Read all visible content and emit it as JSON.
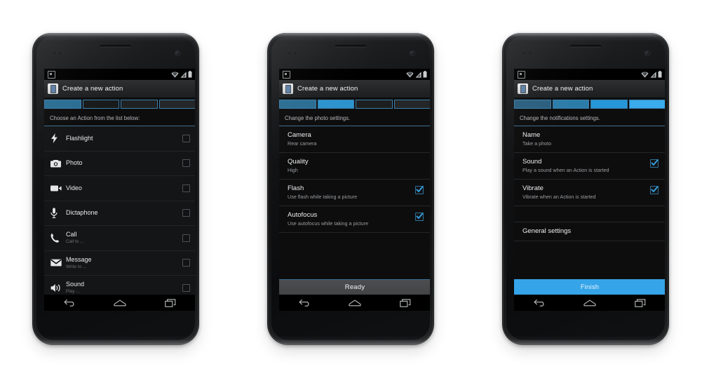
{
  "meta": {
    "app_title": "Create a new action",
    "background": "#ffffff",
    "accent_blue": "#35a4e8"
  },
  "statusbar": {
    "notification_icon": "app-notification-icon",
    "wifi_icon": "wifi-icon",
    "signal_icon": "cellular-signal-icon",
    "battery_icon": "battery-icon"
  },
  "navbar": {
    "back_icon": "back-icon",
    "home_icon": "home-icon",
    "recents_icon": "recent-apps-icon"
  },
  "phones": [
    {
      "id": "phone-1",
      "name": "choose-action-step",
      "action_bar": {
        "title": "Create a new action",
        "icon": "device-icon"
      },
      "progress": {
        "steps": 4,
        "segments": [
          {
            "state": "active",
            "color": "#2b6d93"
          },
          {
            "state": "inactive",
            "color": "#191a1b"
          },
          {
            "state": "inactive",
            "color": "#202122"
          },
          {
            "state": "inactive",
            "color": "#252627"
          }
        ]
      },
      "instruction": "Choose an Action from the list below:",
      "list_style": "action-rows",
      "rows": [
        {
          "icon": "flashlight-icon",
          "title": "Flashlight",
          "subtitle": "",
          "checked": false
        },
        {
          "icon": "photo-camera-icon",
          "title": "Photo",
          "subtitle": "",
          "checked": false
        },
        {
          "icon": "video-camera-icon",
          "title": "Video",
          "subtitle": "",
          "checked": false
        },
        {
          "icon": "microphone-icon",
          "title": "Dictaphone",
          "subtitle": "",
          "checked": false
        },
        {
          "icon": "phone-call-icon",
          "title": "Call",
          "subtitle": "Call to ...",
          "checked": false
        },
        {
          "icon": "envelope-icon",
          "title": "Message",
          "subtitle": "Write to ...",
          "checked": false
        },
        {
          "icon": "speaker-icon",
          "title": "Sound",
          "subtitle": "Play ...",
          "checked": false
        }
      ],
      "footer_button": null
    },
    {
      "id": "phone-2",
      "name": "photo-settings-step",
      "action_bar": {
        "title": "Create a new action",
        "icon": "device-icon"
      },
      "progress": {
        "steps": 4,
        "segments": [
          {
            "state": "done",
            "color": "#2b6d93"
          },
          {
            "state": "active",
            "color": "#2d93cf"
          },
          {
            "state": "inactive",
            "color": "#1d1e1f"
          },
          {
            "state": "inactive",
            "color": "#252627"
          }
        ]
      },
      "instruction": "Change the photo settings.",
      "list_style": "setting-rows",
      "rows": [
        {
          "title": "Camera",
          "subtitle": "Rear camera",
          "checkbox": false,
          "checked": false
        },
        {
          "title": "Quality",
          "subtitle": "High",
          "checkbox": false,
          "checked": false
        },
        {
          "title": "Flash",
          "subtitle": "Use flash while taking a picture",
          "checkbox": true,
          "checked": true
        },
        {
          "title": "Autofocus",
          "subtitle": "Use autofocus while taking a picture",
          "checkbox": true,
          "checked": true
        }
      ],
      "footer_button": {
        "label": "Ready",
        "style": "gray"
      }
    },
    {
      "id": "phone-3",
      "name": "notification-settings-step",
      "action_bar": {
        "title": "Create a new action",
        "icon": "device-icon"
      },
      "progress": {
        "steps": 4,
        "segments": [
          {
            "state": "done",
            "color": "#2b5f7e"
          },
          {
            "state": "done",
            "color": "#2c7ca9"
          },
          {
            "state": "done",
            "color": "#2596d8"
          },
          {
            "state": "active",
            "color": "#3aabec"
          }
        ]
      },
      "instruction": "Change the notifications settings.",
      "list_style": "setting-rows",
      "rows": [
        {
          "title": "Name",
          "subtitle": "Take a photo",
          "checkbox": false,
          "checked": false
        },
        {
          "title": "Sound",
          "subtitle": "Play a sound when an Action is started",
          "checkbox": true,
          "checked": true
        },
        {
          "title": "Vibrate",
          "subtitle": "Vibrate when an Action is started",
          "checkbox": true,
          "checked": true
        },
        {
          "title": "General settings",
          "subtitle": "",
          "checkbox": false,
          "checked": false,
          "spacer_before": true
        }
      ],
      "footer_button": {
        "label": "Finish",
        "style": "blue"
      }
    }
  ]
}
